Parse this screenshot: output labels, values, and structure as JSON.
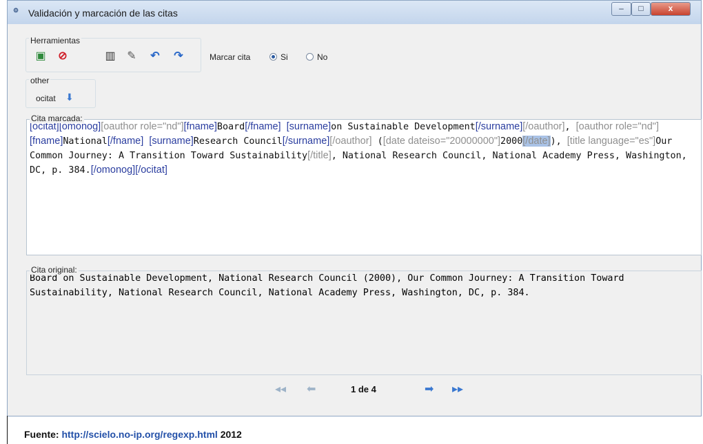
{
  "window": {
    "title": "Validación y marcación de las citas",
    "app_icon": "app-icon",
    "controls": {
      "minimize": "–",
      "maximize": "□",
      "close": "x"
    }
  },
  "toolbar": {
    "group_label": "Herramientas",
    "icons": [
      "save-icon",
      "cancel-icon",
      "delete-icon",
      "edit-icon",
      "undo-icon",
      "redo-icon"
    ],
    "marcar_label": "Marcar cita",
    "options": [
      "Si",
      "No"
    ],
    "selected": "Si"
  },
  "other": {
    "group_label": "other",
    "tag": "ocitat",
    "button_icon": "arrow-down-icon"
  },
  "marked": {
    "label": "Cita marcada:",
    "segments": [
      {
        "t": "[ocitat]",
        "s": "tag"
      },
      {
        "t": "[omonog]",
        "s": "tag"
      },
      {
        "t": "[oauthor role=\"nd\"]",
        "s": "tag2"
      },
      {
        "t": "[fname]",
        "s": "tag"
      },
      {
        "t": "Board",
        "s": "txt"
      },
      {
        "t": "[/fname]",
        "s": "tag"
      },
      {
        "t": " ",
        "s": "txt"
      },
      {
        "t": "[surname]",
        "s": "tag"
      },
      {
        "t": "on Sustainable Development",
        "s": "txt"
      },
      {
        "t": "[/surname]",
        "s": "tag"
      },
      {
        "t": "[/oauthor]",
        "s": "tag2"
      },
      {
        "t": ", ",
        "s": "txt"
      },
      {
        "t": "[oauthor role=\"nd\"]",
        "s": "tag2"
      },
      {
        "t": "[fname]",
        "s": "tag"
      },
      {
        "t": "National",
        "s": "txt"
      },
      {
        "t": "[/fname]",
        "s": "tag"
      },
      {
        "t": " ",
        "s": "txt"
      },
      {
        "t": "[surname]",
        "s": "tag"
      },
      {
        "t": "Research Council",
        "s": "txt"
      },
      {
        "t": "[/surname]",
        "s": "tag"
      },
      {
        "t": "[/oauthor]",
        "s": "tag2"
      },
      {
        "t": " (",
        "s": "txt"
      },
      {
        "t": "[date dateiso=\"20000000\"]",
        "s": "tag2"
      },
      {
        "t": "2000",
        "s": "txt"
      },
      {
        "t": "[/date]",
        "s": "sel"
      },
      {
        "t": "), ",
        "s": "txt"
      },
      {
        "t": "[title language=\"es\"]",
        "s": "tag2"
      },
      {
        "t": "Our Common Journey: A Transition Toward Sustainability",
        "s": "txt"
      },
      {
        "t": "[/title]",
        "s": "tag2"
      },
      {
        "t": ", National Research Council, National Academy Press, Washington, DC, p. 384.",
        "s": "txt"
      },
      {
        "t": "[/omonog]",
        "s": "tag"
      },
      {
        "t": "[/ocitat]",
        "s": "tag"
      }
    ]
  },
  "original": {
    "label": "Cita original:",
    "text": "Board on Sustainable Development, National Research Council (2000), Our Common Journey: A Transition Toward Sustainability, National Research Council, National Academy Press, Washington, DC, p. 384."
  },
  "navigation": {
    "page_label": "1 de 4",
    "icons": [
      "first-icon",
      "prev-icon",
      "next-icon",
      "last-icon"
    ]
  },
  "source": {
    "prefix": "Fuente:",
    "link": "http://scielo.no-ip.org/regexp.html",
    "year": "2012"
  }
}
